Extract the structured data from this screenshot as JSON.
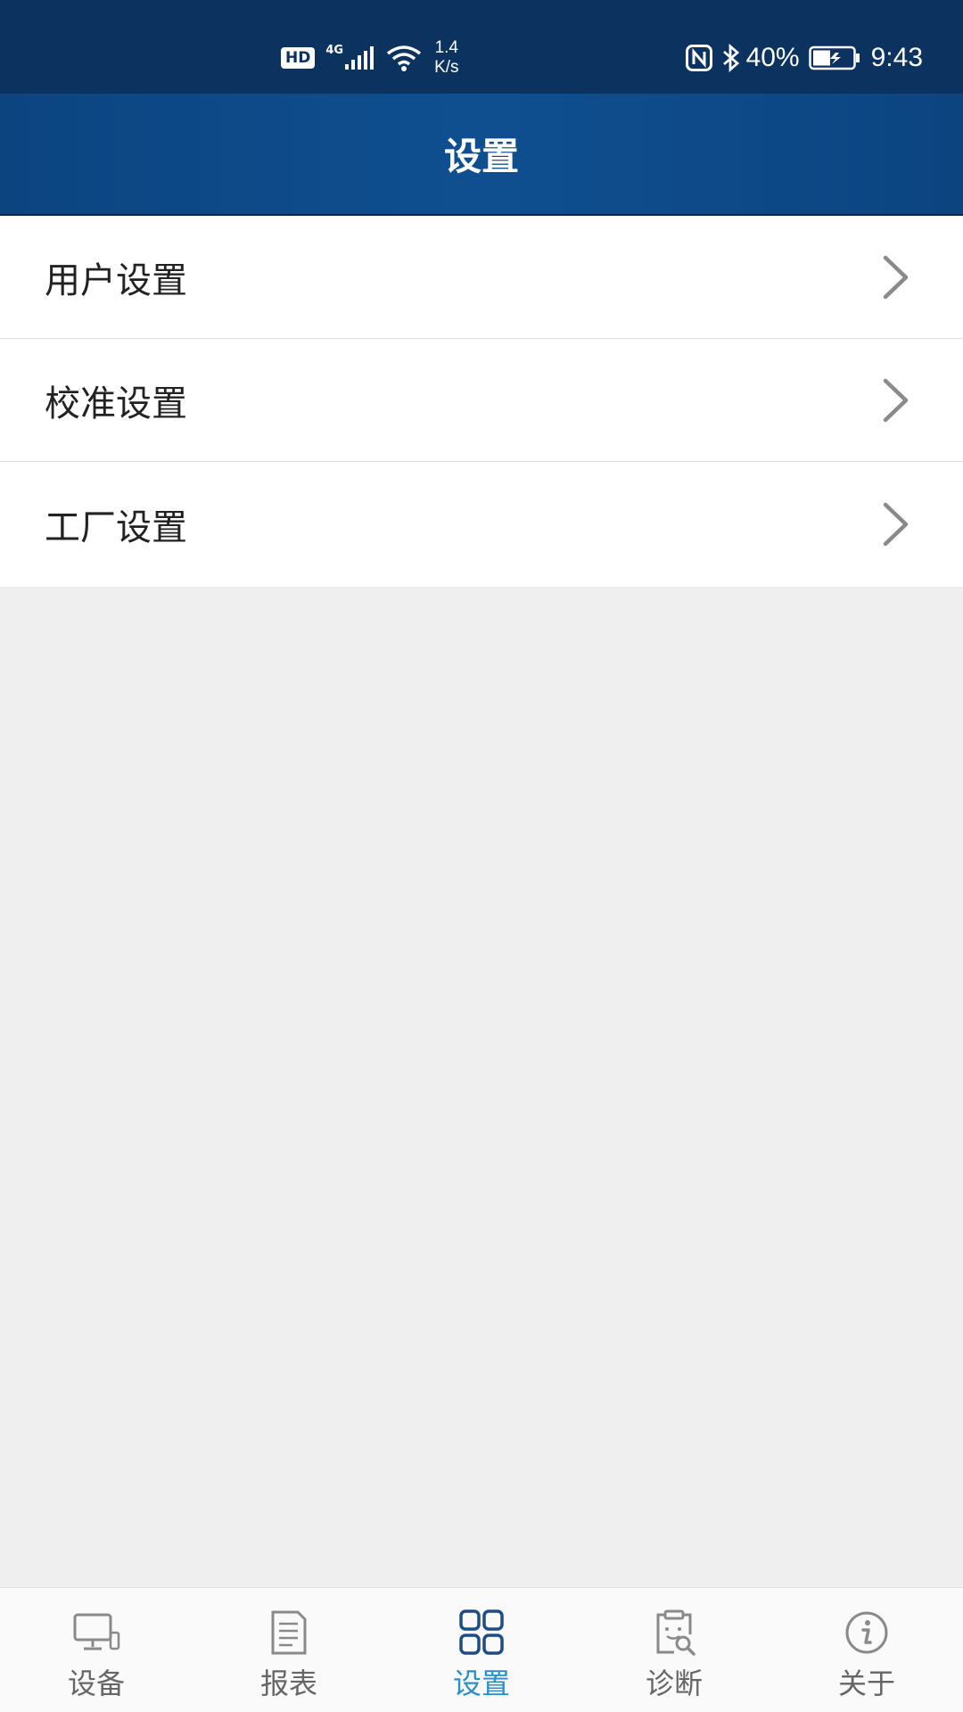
{
  "status_bar": {
    "hd": "HD",
    "network": "4G",
    "speed_value": "1.4",
    "speed_unit": "K/s",
    "battery_percent": "40%",
    "time": "9:43"
  },
  "header": {
    "title": "设置"
  },
  "settings": {
    "items": [
      {
        "label": "用户设置"
      },
      {
        "label": "校准设置"
      },
      {
        "label": "工厂设置"
      }
    ]
  },
  "bottom_nav": {
    "active_index": 2,
    "active_color": "#2a8fc8",
    "inactive_color": "#666666",
    "tabs": [
      {
        "label": "设备",
        "icon": "monitor-icon"
      },
      {
        "label": "报表",
        "icon": "document-icon"
      },
      {
        "label": "设置",
        "icon": "grid-icon"
      },
      {
        "label": "诊断",
        "icon": "clipboard-search-icon"
      },
      {
        "label": "关于",
        "icon": "info-icon"
      }
    ]
  }
}
